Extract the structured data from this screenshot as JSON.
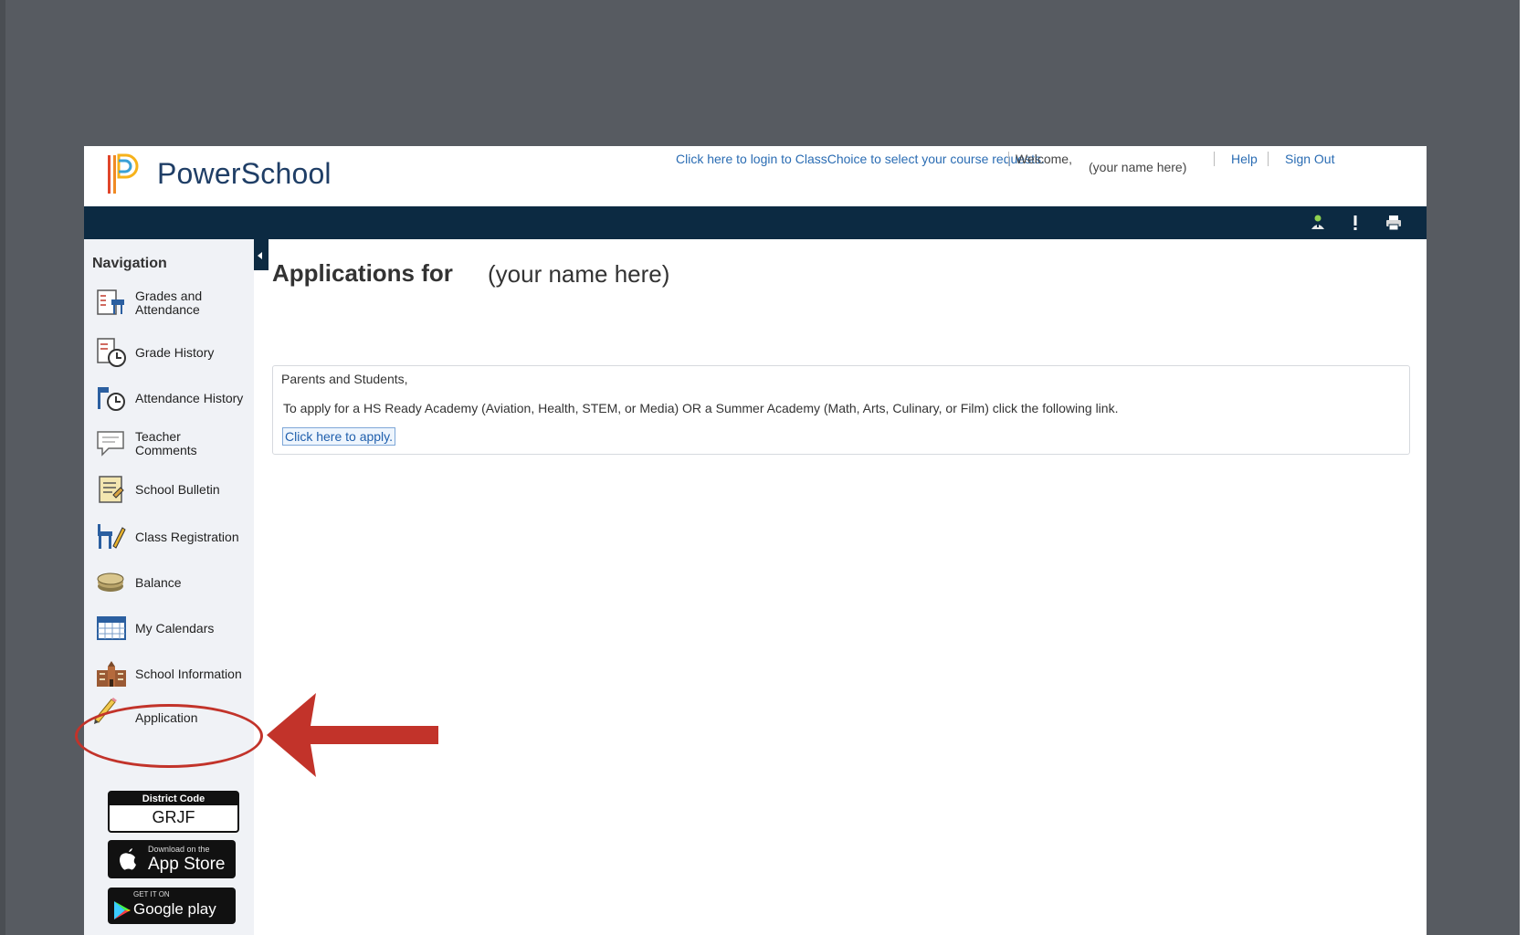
{
  "app": {
    "brand": "PowerSchool"
  },
  "header": {
    "classchoice_link": "Click here to login to ClassChoice to select your course requests.",
    "welcome": "Welcome,",
    "user_name": "(your name here)",
    "help": "Help",
    "sign_out": "Sign Out"
  },
  "toolbar": {
    "icons": [
      "person-alert-icon",
      "exclamation-icon",
      "printer-icon"
    ]
  },
  "sidebar": {
    "title": "Navigation",
    "items": [
      {
        "label": "Grades and Attendance",
        "icon": "grades-icon"
      },
      {
        "label": "Grade History",
        "icon": "grade-history-icon"
      },
      {
        "label": "Attendance History",
        "icon": "attendance-history-icon"
      },
      {
        "label": "Teacher Comments",
        "icon": "comment-icon"
      },
      {
        "label": "School Bulletin",
        "icon": "bulletin-icon"
      },
      {
        "label": "Class Registration",
        "icon": "class-registration-icon"
      },
      {
        "label": "Balance",
        "icon": "coins-icon"
      },
      {
        "label": "My Calendars",
        "icon": "calendar-icon"
      },
      {
        "label": "School Information",
        "icon": "school-icon"
      },
      {
        "label": "Application",
        "icon": "pencil-icon"
      }
    ],
    "district_code_label": "District Code",
    "district_code": "GRJF",
    "app_store_small": "Download on the",
    "app_store_big": "App Store",
    "google_play_small": "GET IT ON",
    "google_play_big": "Google play"
  },
  "main": {
    "title": "Applications for",
    "name": "(your name here)",
    "greeting": "Parents and Students,",
    "body": "To apply for a HS Ready Academy (Aviation, Health, STEM, or Media) OR a Summer Academy (Math, Arts, Culinary, or Film) click the following link.",
    "apply_link": "Click here to apply."
  },
  "colors": {
    "backdrop": "#575b61",
    "toolbar": "#0c2a42",
    "link": "#2a6cb3",
    "annotation": "#c2332a"
  }
}
